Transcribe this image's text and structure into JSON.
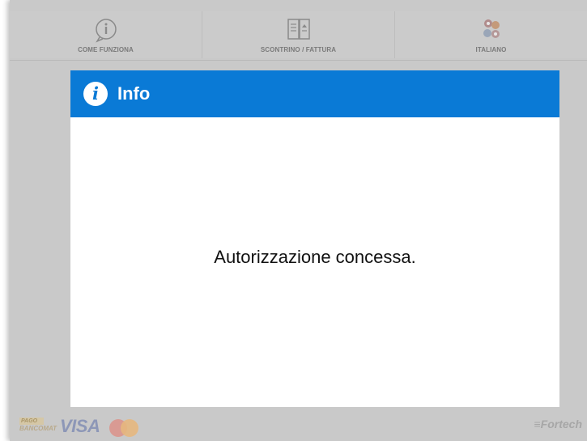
{
  "topbar": {
    "tabs": [
      {
        "label": "COME FUNZIONA",
        "icon": "info-circle-icon"
      },
      {
        "label": "SCONTRINO / FATTURA",
        "icon": "receipt-icon"
      },
      {
        "label": "ITALIANO",
        "icon": "flags-icon"
      }
    ]
  },
  "dialog": {
    "title": "Info",
    "icon": "info-icon",
    "message": "Autorizzazione concessa."
  },
  "footer": {
    "pago_line1": "PAGO",
    "pago_line2": "BANCOMAT",
    "visa": "VISA",
    "mastercard_icon": "mastercard-icon",
    "brand": "Fortech"
  },
  "colors": {
    "header": "#0a7ad6",
    "overlay": "#c9c9c9"
  }
}
